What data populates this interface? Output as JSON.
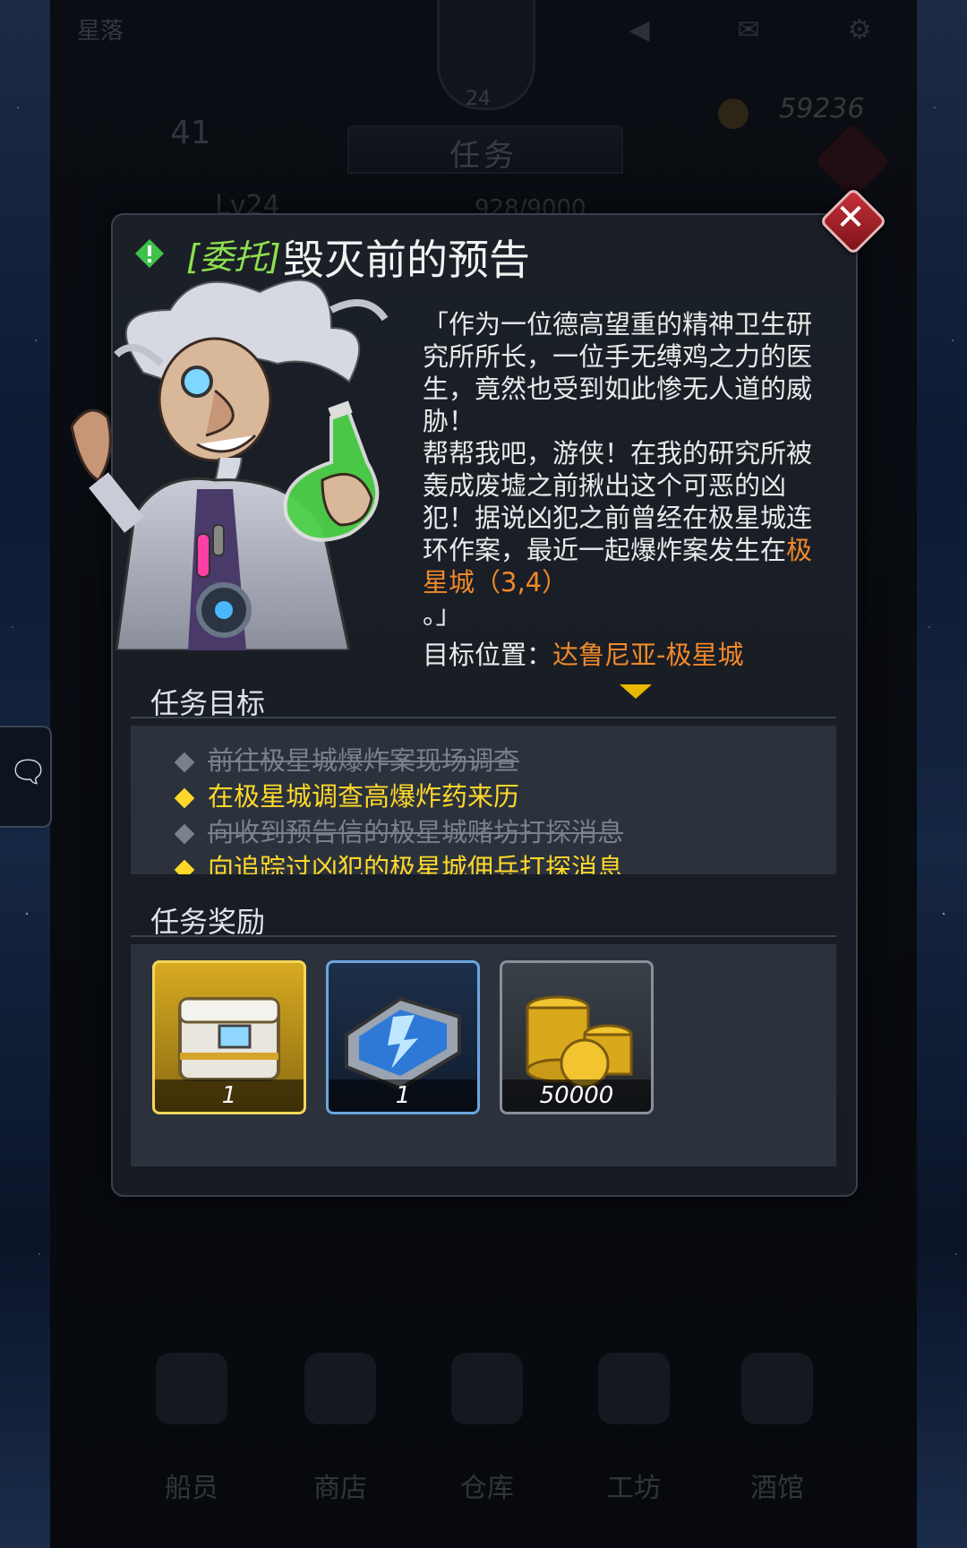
{
  "background": {
    "player_name": "星落",
    "emblem_level": "24",
    "coins": "59236",
    "energy": "41",
    "level": "Lv24",
    "xp": "928/9000",
    "tab_title": "任务",
    "nav": [
      "船员",
      "商店",
      "仓库",
      "工坊",
      "酒馆"
    ]
  },
  "dialog": {
    "title_tag": "[委托]",
    "title": "毁灭前的预告",
    "quote_lines": [
      "「作为一位德高望重的精神卫生研",
      "究所所长，一位手无缚鸡之力的医",
      "生，竟然也受到如此惨无人道的威",
      "胁！",
      "帮帮我吧，游侠！在我的研究所被",
      "轰成废墟之前揪出这个可恶的凶",
      "犯！据说凶犯之前曾经在极星城连",
      "环作案，最近一起爆炸案发生在"
    ],
    "quote_highlight_1": "极",
    "quote_highlight_2": "星城（3,4）",
    "quote_end": "。」",
    "target_label": "目标位置：",
    "target_value": "达鲁尼亚-极星城",
    "objectives_header": "任务目标",
    "objectives": [
      {
        "text": "前往极星城爆炸案现场调查",
        "status": "done"
      },
      {
        "text": "在极星城调查高爆炸药来历",
        "status": "active"
      },
      {
        "text": "向收到预告信的极星城赌坊打探消息",
        "status": "done"
      },
      {
        "text": "向追踪过凶犯的极星城佣兵打探消息",
        "status": "active"
      }
    ],
    "rewards_header": "任务奖励",
    "rewards": [
      {
        "icon": "supply-crate-icon",
        "count": "1",
        "rarity": "gold"
      },
      {
        "icon": "energy-chest-icon",
        "count": "1",
        "rarity": "blue"
      },
      {
        "icon": "gold-coins-icon",
        "count": "50000",
        "rarity": "gray"
      }
    ]
  },
  "colors": {
    "accent_orange": "#f0892a",
    "objective_active": "#ffd82a",
    "tag_green": "#8ee04e",
    "close_red": "#c8323a"
  }
}
